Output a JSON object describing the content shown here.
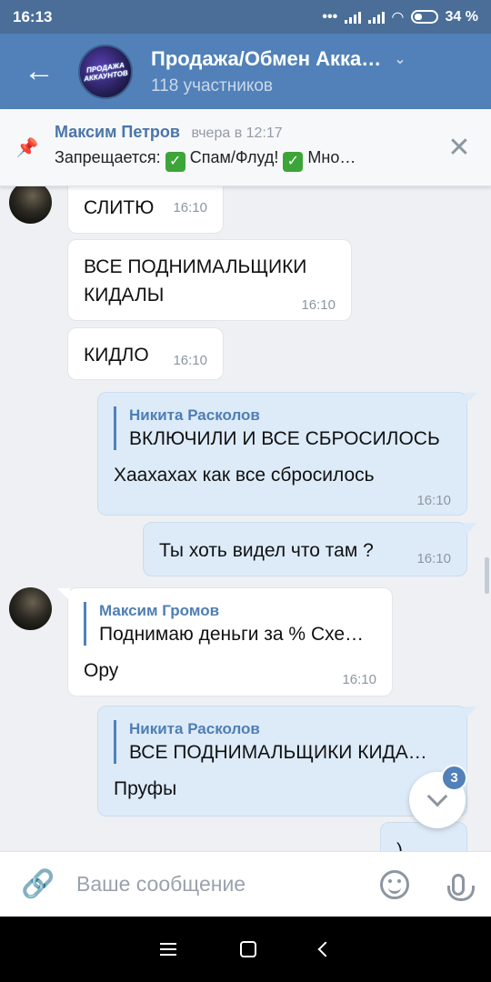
{
  "status": {
    "time": "16:13",
    "battery": "34 %"
  },
  "header": {
    "title": "Продажа/Обмен Акка…",
    "subtitle": "118 участников",
    "avatar_text_1": "ПРОДАЖА",
    "avatar_text_2": "АККАУНТОВ"
  },
  "pinned": {
    "author": "Максим Петров",
    "time": "вчера в 12:17",
    "text_prefix": "Запрещается:",
    "item1": "Спам/Флуд!",
    "item2": "Мно…"
  },
  "messages": [
    {
      "text": "СЛИТЮ",
      "time": "16:10"
    },
    {
      "text": "ВСЕ ПОДНИМАЛЬЩИКИ КИДАЛЫ",
      "time": "16:10"
    },
    {
      "text": "КИДЛО",
      "time": "16:10"
    },
    {
      "reply_author": "Никита Расколов",
      "reply_text": "ВКЛЮЧИЛИ И ВСЕ СБРОСИЛОСЬ",
      "text": "Хаахахах как все сбросилось",
      "time": "16:10"
    },
    {
      "text": "Ты хоть видел что там ?",
      "time": "16:10"
    },
    {
      "reply_author": "Максим Громов",
      "reply_text": "Поднимаю деньги за % Схе…",
      "text": "Ору",
      "time": "16:10"
    },
    {
      "reply_author": "Никита Расколов",
      "reply_text": "ВСЕ ПОДНИМАЛЬЩИКИ КИДА…",
      "text": "Пруфы"
    },
    {
      "text": ")"
    }
  ],
  "unread_badge": "3",
  "composer": {
    "placeholder": "Ваше сообщение"
  },
  "colors": {
    "header": "#5181b8",
    "status_bar": "#4a6e98",
    "outgoing_bubble": "#ddebf9",
    "accent": "#4a76a8",
    "check_emoji": "#3ca538"
  },
  "icons": [
    "back-arrow-icon",
    "chevron-down-icon",
    "pin-icon",
    "close-icon",
    "check-emoji-icon",
    "attach-icon",
    "emoji-icon",
    "microphone-icon",
    "scroll-down-icon"
  ]
}
